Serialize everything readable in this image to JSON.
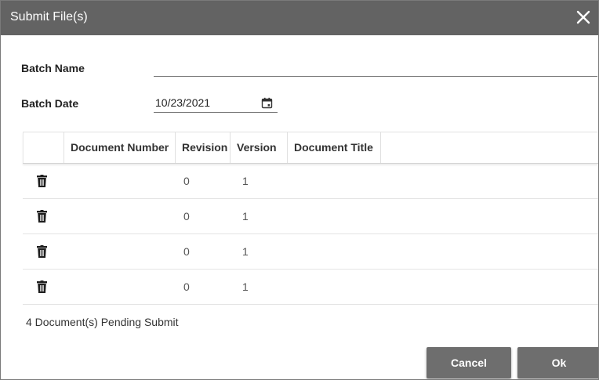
{
  "dialog": {
    "title": "Submit File(s)",
    "close_icon": "close-icon"
  },
  "form": {
    "batch_name_label": "Batch Name",
    "batch_name_value": "",
    "batch_date_label": "Batch Date",
    "batch_date_value": "10/23/2021",
    "calendar_icon": "calendar-icon"
  },
  "table": {
    "columns": [
      "",
      "Document Number",
      "Revision",
      "Version",
      "Document Title"
    ],
    "rows": [
      {
        "document_number": "",
        "revision": "0",
        "version": "1",
        "document_title": ""
      },
      {
        "document_number": "",
        "revision": "0",
        "version": "1",
        "document_title": ""
      },
      {
        "document_number": "",
        "revision": "0",
        "version": "1",
        "document_title": ""
      },
      {
        "document_number": "",
        "revision": "0",
        "version": "1",
        "document_title": ""
      }
    ],
    "row_icon": "trash-icon"
  },
  "status": {
    "pending_text": "4 Document(s) Pending Submit"
  },
  "buttons": {
    "cancel_label": "Cancel",
    "ok_label": "Ok"
  },
  "colors": {
    "titlebar": "#636363",
    "button": "#6e6e6e",
    "text": "#222222"
  }
}
